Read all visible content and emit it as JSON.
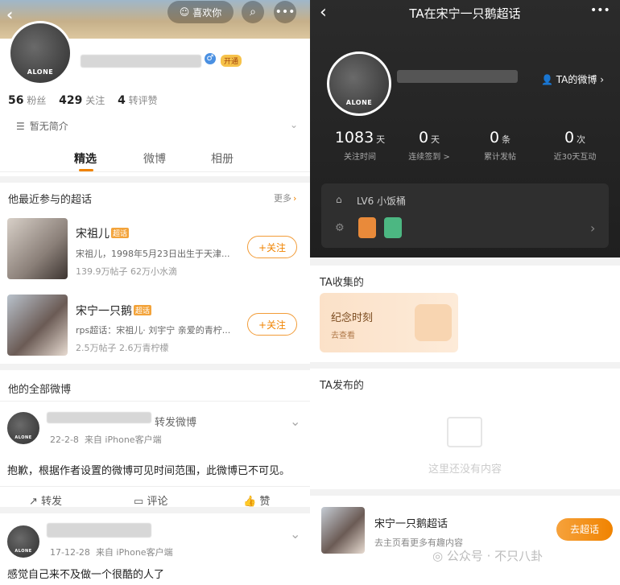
{
  "left": {
    "header": {
      "back_icon": "chevron-left-icon",
      "like_label": "喜欢你",
      "search_icon": "search-icon",
      "more_icon": "more-icon"
    },
    "profile": {
      "avatar_text": "ALONE",
      "vip_badge": "开通",
      "fans_num": "56",
      "fans_label": "粉丝",
      "follow_num": "429",
      "follow_label": "关注",
      "repost_num": "4",
      "repost_label": "转评赞",
      "intro": "暂无简介"
    },
    "tabs": [
      "精选",
      "微博",
      "相册"
    ],
    "supertopics": {
      "title": "他最近参与的超话",
      "more": "更多",
      "chip": "超话",
      "items": [
        {
          "name": "宋祖儿",
          "desc": "宋祖儿，1998年5月23日出生于天津...",
          "meta": "139.9万帖子 62万小水滴",
          "btn": "+关注"
        },
        {
          "name": "宋宁一只鹅",
          "desc": "rps超话：宋祖儿· 刘宇宁 亲爱的青柠...",
          "meta": "2.5万帖子 2.6万青柠檬",
          "btn": "+关注"
        }
      ]
    },
    "all_weibo": {
      "title": "他的全部微博",
      "post1": {
        "action": "转发微博",
        "date": "22-2-8",
        "source": "来自 iPhone客户端",
        "content": "抱歉，根据作者设置的微博可见时间范围，此微博已不可见。"
      },
      "actions": [
        "转发",
        "评论",
        "赞"
      ],
      "post2": {
        "date": "17-12-28",
        "source": "来自 iPhone客户端",
        "content": "感觉自己来不及做一个很酷的人了"
      }
    }
  },
  "right": {
    "header": {
      "title": "TA在宋宁一只鹅超话",
      "back_icon": "chevron-left-icon",
      "more_icon": "more-icon"
    },
    "profile": {
      "avatar_text": "ALONE",
      "weibo_link": "TA的微博"
    },
    "stats": [
      {
        "num": "1083",
        "unit": "天",
        "label": "关注时间"
      },
      {
        "num": "0",
        "unit": "天",
        "label": "连续签到 >"
      },
      {
        "num": "0",
        "unit": "条",
        "label": "累计发帖"
      },
      {
        "num": "0",
        "unit": "次",
        "label": "近30天互动"
      }
    ],
    "level": "LV6 小饭桶",
    "collect": {
      "title": "TA收集的",
      "card_title": "纪念时刻",
      "card_sub": "去查看"
    },
    "publish": {
      "title": "TA发布的",
      "empty": "这里还没有内容"
    },
    "footer": {
      "name": "宋宁一只鹅超话",
      "sub": "去主页看更多有趣内容",
      "btn": "去超话"
    },
    "watermark": "公众号 · 不只八卦"
  }
}
